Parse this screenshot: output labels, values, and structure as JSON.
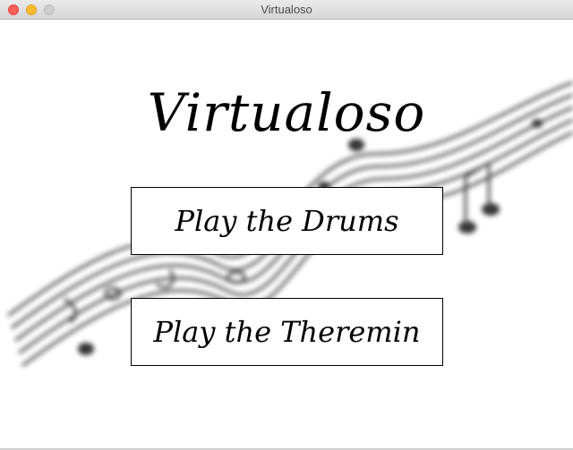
{
  "window": {
    "title": "Virtualoso",
    "controls": [
      "close",
      "minimize",
      "zoom"
    ]
  },
  "app": {
    "title": "Virtualoso",
    "background_icon": "music-staff-art"
  },
  "buttons": {
    "drums_label": "Play the Drums",
    "theremin_label": "Play the Theremin"
  },
  "colors": {
    "close": "#fc5f57",
    "minimize": "#fdbc2e",
    "zoom": "#cfcfcf",
    "text": "#000000",
    "background": "#ffffff"
  }
}
